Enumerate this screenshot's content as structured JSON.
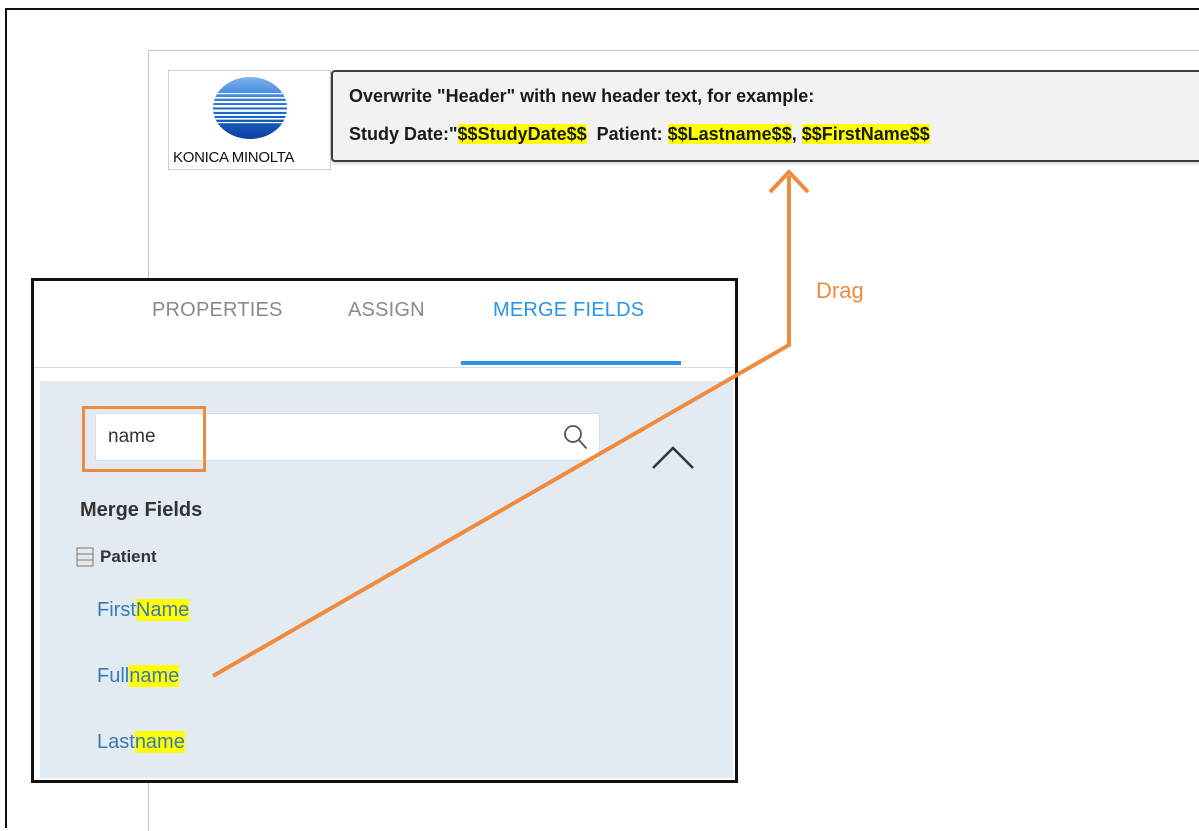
{
  "logo": {
    "brand_text": "KONICA MINOLTA"
  },
  "header_box": {
    "line1": "Overwrite \"Header\" with new header text, for example:",
    "line2_prefix": "Study Date:\"",
    "token_study_date": "$$StudyDate$$",
    "line2_patient": "  Patient: ",
    "token_lastname": "$$Lastname$$",
    "separator": ", ",
    "token_firstname": "$$FirstName$$"
  },
  "annotation": {
    "drag_label": "Drag",
    "color": "#f08a3c"
  },
  "panel": {
    "tabs": [
      {
        "label": "PROPERTIES",
        "active": false
      },
      {
        "label": "ASSIGN",
        "active": false
      },
      {
        "label": "MERGE FIELDS",
        "active": true
      }
    ],
    "search": {
      "value": "name"
    },
    "section_title": "Merge Fields",
    "category": "Patient",
    "fields": [
      {
        "prefix": "First",
        "match": "Name"
      },
      {
        "prefix": "Full",
        "match": "name"
      },
      {
        "prefix": "Last",
        "match": "name"
      }
    ]
  },
  "colors": {
    "accent_blue": "#2a95e8",
    "highlight_yellow": "#ffff00",
    "panel_background": "#e3ebf2",
    "link_blue": "#3a79b8"
  }
}
